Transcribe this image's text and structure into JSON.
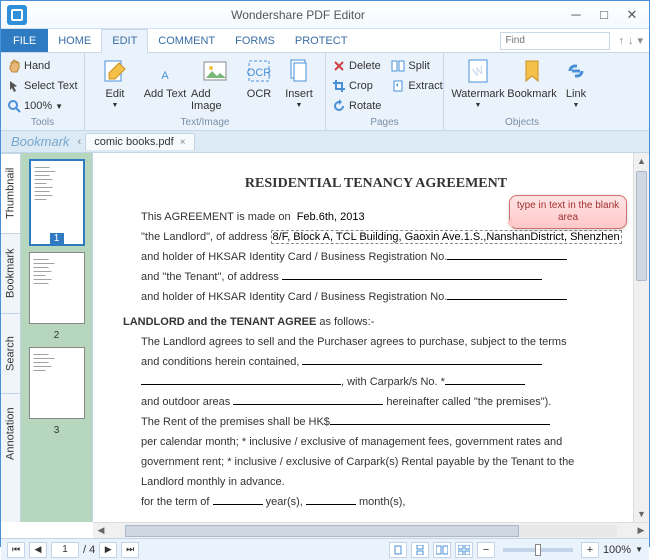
{
  "app": {
    "title": "Wondershare PDF Editor"
  },
  "menu": {
    "file": "FILE",
    "tabs": [
      "HOME",
      "EDIT",
      "COMMENT",
      "FORMS",
      "PROTECT"
    ],
    "active": 1,
    "search_placeholder": "Find"
  },
  "ribbon": {
    "tools": {
      "label": "Tools",
      "hand": "Hand",
      "select": "Select Text",
      "zoom": "100%"
    },
    "textimage": {
      "label": "Text/Image",
      "edit": "Edit",
      "addtext": "Add Text",
      "addimage": "Add Image",
      "ocr": "OCR",
      "insert": "Insert"
    },
    "pages": {
      "label": "Pages",
      "delete": "Delete",
      "crop": "Crop",
      "rotate": "Rotate",
      "split": "Split",
      "extract": "Extract"
    },
    "objects": {
      "label": "Objects",
      "watermark": "Watermark",
      "bookmark": "Bookmark",
      "link": "Link"
    }
  },
  "bookmark_label": "Bookmark",
  "doc_tab": {
    "name": "comic books.pdf"
  },
  "side_tabs": [
    "Thumbnail",
    "Bookmark",
    "Search",
    "Annotation"
  ],
  "thumbs": [
    1,
    2,
    3
  ],
  "callout": "type in text in the blank area",
  "document": {
    "title": "RESIDENTIAL TENANCY AGREEMENT",
    "line1_a": "This AGREEMENT is made on",
    "line1_date": "Feb.6th, 2013",
    "line2_a": "\"the Landlord\", of address",
    "line2_addr": "8/F, Block A, TCL Building, Gaoxin Ave.1.S.,NanshanDistrict, Shenzhen",
    "line3": "and holder of HKSAR Identity Card / Business Registration No.",
    "line4": "and \"the Tenant\", of address",
    "line5": "and holder of HKSAR Identity Card / Business Registration No.",
    "agree_hdr": "LANDLORD and the TENANT AGREE",
    "agree_sfx": " as follows:-",
    "p1": "The Landlord agrees to sell and the Purchaser agrees to purchase, subject to the terms",
    "p2": "and conditions herein contained, ",
    "p3_a": ", with Carpark/s No. *",
    "p4_a": "and outdoor areas ",
    "p4_b": " hereinafter called \"the premises\").",
    "p5": "The Rent of the premises shall be HK$",
    "p6": "per calendar month;  * inclusive / exclusive of management fees, government rates and",
    "p7": "government rent; * inclusive / exclusive of Carpark(s) Rental payable by the Tenant to the",
    "p8": "Landlord monthly in advance.",
    "p9_a": "for the term of ",
    "p9_b": " year(s), ",
    "p9_c": " month(s),"
  },
  "status": {
    "page": "1",
    "total": "/ 4",
    "zoom": "100%"
  }
}
